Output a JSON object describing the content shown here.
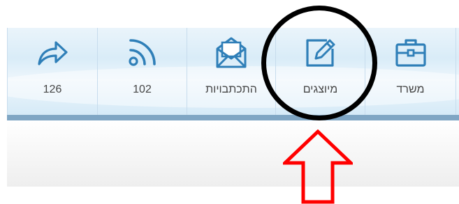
{
  "toolbar": {
    "buttons": [
      {
        "label": "126",
        "icon": "share-forward-icon"
      },
      {
        "label": "102",
        "icon": "rss-feed-icon"
      },
      {
        "label": "התכתבויות",
        "icon": "open-envelope-icon"
      },
      {
        "label": "מיוצגים",
        "icon": "edit-note-icon"
      },
      {
        "label": "משרד",
        "icon": "briefcase-icon"
      }
    ]
  },
  "colors": {
    "icon_blue": "#2f7fb8",
    "highlight_circle": "#000000",
    "annotation_arrow": "#ff0000",
    "bar_blue": "#7fa6c4"
  },
  "annotations": {
    "circle_target": "מיוצגים",
    "arrow_direction": "up"
  }
}
